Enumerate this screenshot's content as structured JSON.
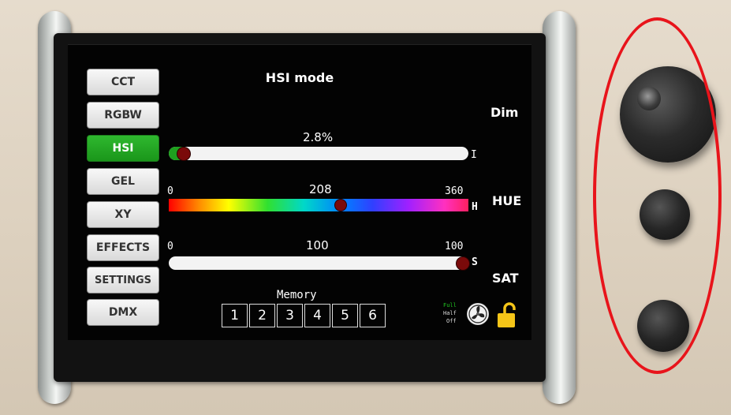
{
  "sidebar": {
    "items": [
      {
        "label": "CCT"
      },
      {
        "label": "RGBW"
      },
      {
        "label": "HSI"
      },
      {
        "label": "GEL"
      },
      {
        "label": "XY"
      },
      {
        "label": "EFFECTS"
      },
      {
        "label": "SETTINGS"
      },
      {
        "label": "DMX"
      }
    ],
    "active_index": 2
  },
  "screen": {
    "title": "HSI mode",
    "dim": {
      "value": "2.8%",
      "fraction": 0.028,
      "axis": "I",
      "side_label": "Dim"
    },
    "hue": {
      "min": "0",
      "max": "360",
      "value": "208",
      "fraction": 0.578,
      "axis": "H",
      "side_label": "HUE"
    },
    "sat": {
      "min": "0",
      "max": "100",
      "value": "100",
      "fraction": 1.0,
      "axis": "S",
      "side_label": "SAT"
    },
    "memory": {
      "label": "Memory",
      "slots": [
        "1",
        "2",
        "3",
        "4",
        "5",
        "6"
      ]
    },
    "fan": {
      "full": "Full",
      "half": "Half",
      "off": "Off"
    }
  },
  "icons": [
    "fan-icon",
    "lock-open-icon"
  ],
  "colors": {
    "active_green": "#1f9e1f",
    "lock_yellow": "#f5c518",
    "knob_dark_red": "#7a0a0a",
    "annotation_red": "#e8141b"
  }
}
